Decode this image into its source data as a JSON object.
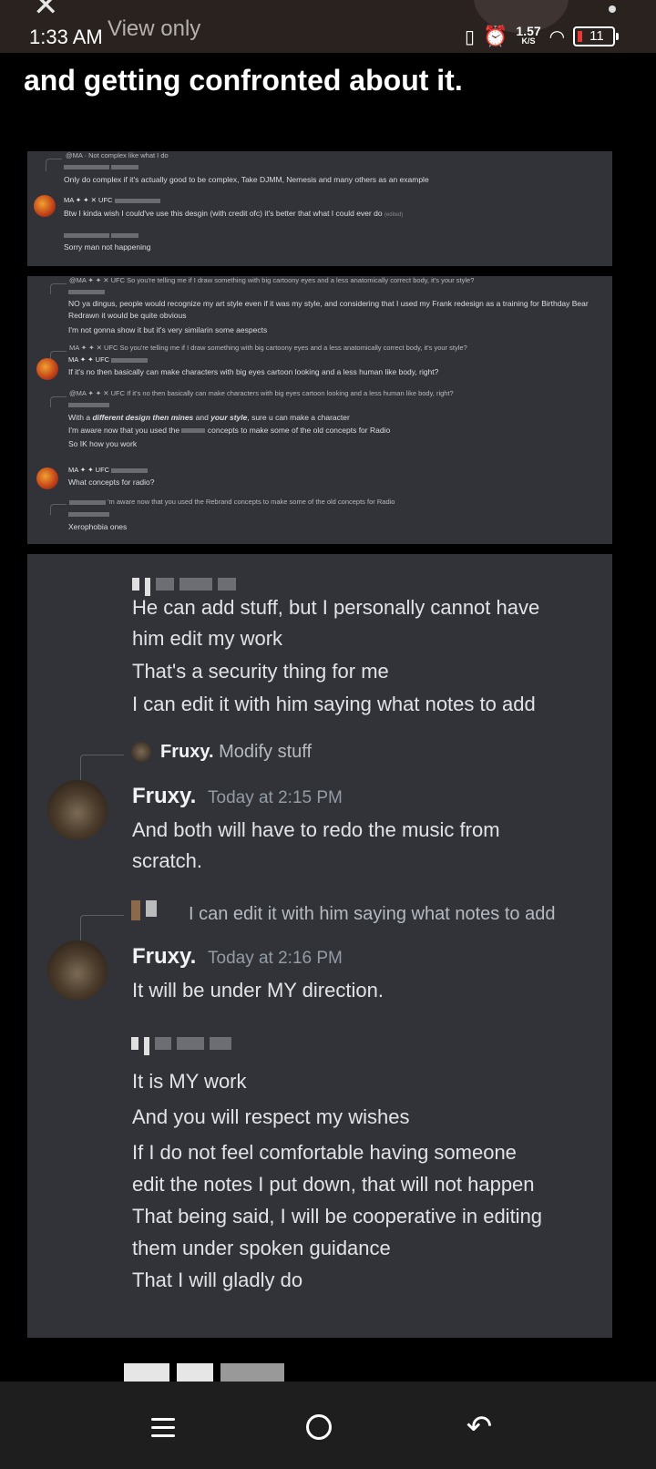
{
  "status_bar": {
    "time": "1:33 AM",
    "view_only": "View only",
    "net_speed": "1.57",
    "net_unit": "K/S",
    "battery": "11",
    "icons": [
      "close-icon",
      "vibrate-icon",
      "alarm-icon",
      "wifi-icon",
      "battery-icon",
      "more-icon"
    ]
  },
  "headline": "and getting confronted about it.",
  "panel1": {
    "reply1": "Not complex like what I do",
    "reply1_tags": "@MA",
    "msg1": "Only do complex if it's actually good to be complex, Take DJMM, Nemesis and many others as an example",
    "name2": "MA",
    "badge": "UFC",
    "msg2": "Btw I kinda wish I could've use this desgin (with credit ofc) it's better that what I could ever do",
    "msg2_edited": "(edited)",
    "msg3": "Sorry man not happening"
  },
  "panel2": {
    "reply1": "So you're telling me if I draw something with big cartoony eyes and a less anatomically correct body, it's your style?",
    "msg1a": "NO ya dingus, people would recognize my art style even if it was my style, and considering that I used my Frank redesign as a training for Birthday Bear",
    "msg1b": "Redrawn it would be quite obvious",
    "msg1c": "I'm not gonna show it but it's very similarin some aespects",
    "reply2": "So you're telling me if I draw something with big cartoony eyes and a less anatomically correct body, it's your style?",
    "name2": "MA",
    "badge": "UFC",
    "msg2": "If it's no then basically can make characters with big eyes cartoon looking and a less human like body, right?",
    "reply3": "If it's no then basically can make characters with big eyes cartoon looking and a less human like body, right?",
    "msg3a_pre": "With a ",
    "msg3a_bold": "different design then mines",
    "msg3a_mid": " and ",
    "msg3a_bold2": "your style",
    "msg3a_post": ", sure u can make a character",
    "msg3b_pre": "I'm aware now that you used the",
    "msg3b_post": "concepts to make some of the old concepts for Radio",
    "msg3c": "So IK how you work",
    "name4": "MA",
    "msg4": "What concepts for radio?",
    "reply5": "'m aware now that you used the Rebrand concepts to make some of the old concepts for Radio",
    "msg5": "Xerophobia ones"
  },
  "panel3": {
    "msg1": [
      "He can add stuff, but I personally cannot have",
      "him edit my work",
      "That's a security thing for me",
      "I can edit it with him saying what notes to add"
    ],
    "reply1_name": "Fruxy.",
    "reply1_text": "Modify stuff",
    "author": "Fruxy.",
    "ts1": "Today at 2:15 PM",
    "msg2": [
      "And both will have to redo the music from",
      "scratch."
    ],
    "reply2_text": "I can edit it with him saying what notes to add",
    "ts2": "Today at 2:16 PM",
    "msg3": "It will be under MY direction.",
    "msg4": [
      "It is MY work",
      "And you will respect my wishes",
      "If I do not feel comfortable having someone",
      "edit the notes I put down, that will not happen",
      "That being said, I will be cooperative in editing",
      "them under spoken guidance",
      "That I will gladly do"
    ]
  },
  "nav": {
    "icons": [
      "recents-icon",
      "home-icon",
      "back-icon"
    ]
  }
}
